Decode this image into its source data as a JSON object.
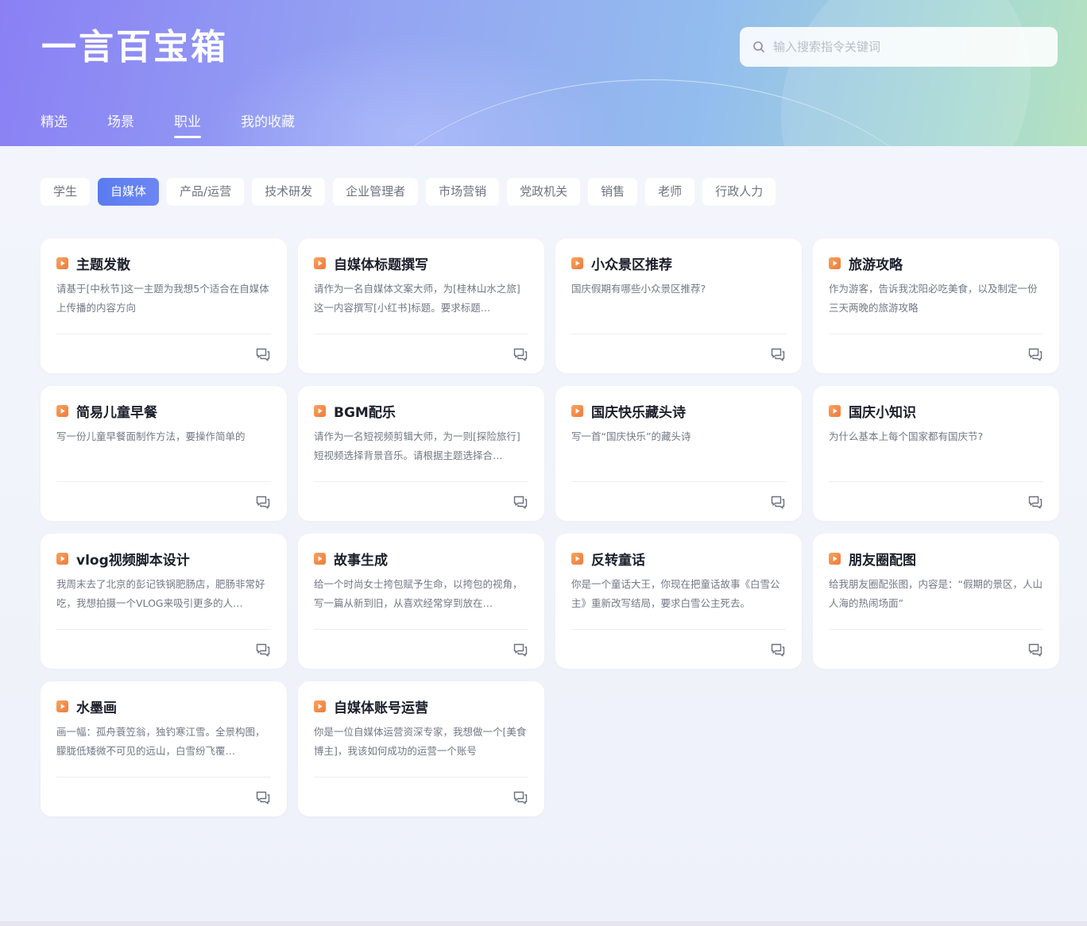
{
  "app": {
    "title": "一言百宝箱"
  },
  "search": {
    "placeholder": "输入搜索指令关键词"
  },
  "nav": {
    "tabs": [
      {
        "label": "精选",
        "active": false
      },
      {
        "label": "场景",
        "active": false
      },
      {
        "label": "职业",
        "active": true
      },
      {
        "label": "我的收藏",
        "active": false
      }
    ]
  },
  "categories": {
    "items": [
      {
        "label": "学生",
        "active": false
      },
      {
        "label": "自媒体",
        "active": true
      },
      {
        "label": "产品/运营",
        "active": false
      },
      {
        "label": "技术研发",
        "active": false
      },
      {
        "label": "企业管理者",
        "active": false
      },
      {
        "label": "市场营销",
        "active": false
      },
      {
        "label": "党政机关",
        "active": false
      },
      {
        "label": "销售",
        "active": false
      },
      {
        "label": "老师",
        "active": false
      },
      {
        "label": "行政人力",
        "active": false
      }
    ]
  },
  "cards": [
    {
      "title": "主题发散",
      "desc": "请基于[中秋节]这一主题为我想5个适合在自媒体上传播的内容方向"
    },
    {
      "title": "自媒体标题撰写",
      "desc": "请作为一名自媒体文案大师，为[桂林山水之旅]这一内容撰写[小红书]标题。要求标题…"
    },
    {
      "title": "小众景区推荐",
      "desc": "国庆假期有哪些小众景区推荐?"
    },
    {
      "title": "旅游攻略",
      "desc": "作为游客，告诉我沈阳必吃美食，以及制定一份三天两晚的旅游攻略"
    },
    {
      "title": "简易儿童早餐",
      "desc": "写一份儿童早餐面制作方法，要操作简单的"
    },
    {
      "title": "BGM配乐",
      "desc": "请作为一名短视频剪辑大师，为一则[探险旅行]短视频选择背景音乐。请根据主题选择合…"
    },
    {
      "title": "国庆快乐藏头诗",
      "desc": "写一首“国庆快乐”的藏头诗"
    },
    {
      "title": "国庆小知识",
      "desc": "为什么基本上每个国家都有国庆节?"
    },
    {
      "title": "vlog视频脚本设计",
      "desc": "我周末去了北京的彭记铁锅肥肠店，肥肠非常好吃，我想拍摄一个VLOG来吸引更多的人…"
    },
    {
      "title": "故事生成",
      "desc": "给一个时尚女士挎包赋予生命，以挎包的视角，写一篇从新到旧，从喜欢经常穿到放在…"
    },
    {
      "title": "反转童话",
      "desc": "你是一个童话大王，你现在把童话故事《白雪公主》重新改写结局，要求白雪公主死去。"
    },
    {
      "title": "朋友圈配图",
      "desc": "给我朋友圈配张图，内容是：“假期的景区，人山人海的热闹场面”"
    },
    {
      "title": "水墨画",
      "desc": "画一幅：孤舟蓑笠翁，独钓寒江雪。全景构图，朦胧低矮微不可见的远山，白雪纷飞覆…"
    },
    {
      "title": "自媒体账号运营",
      "desc": "你是一位自媒体运营资深专家，我想做一个[美食博主]，我该如何成功的运营一个账号"
    }
  ],
  "icons": {
    "search": "search-icon",
    "card_tag": "play-icon",
    "card_action": "chat-icon"
  },
  "colors": {
    "accent": "#5a7cf0",
    "tag_orange": "#f28a4a",
    "title_text": "#1c1f2b",
    "desc_text": "#737886"
  }
}
